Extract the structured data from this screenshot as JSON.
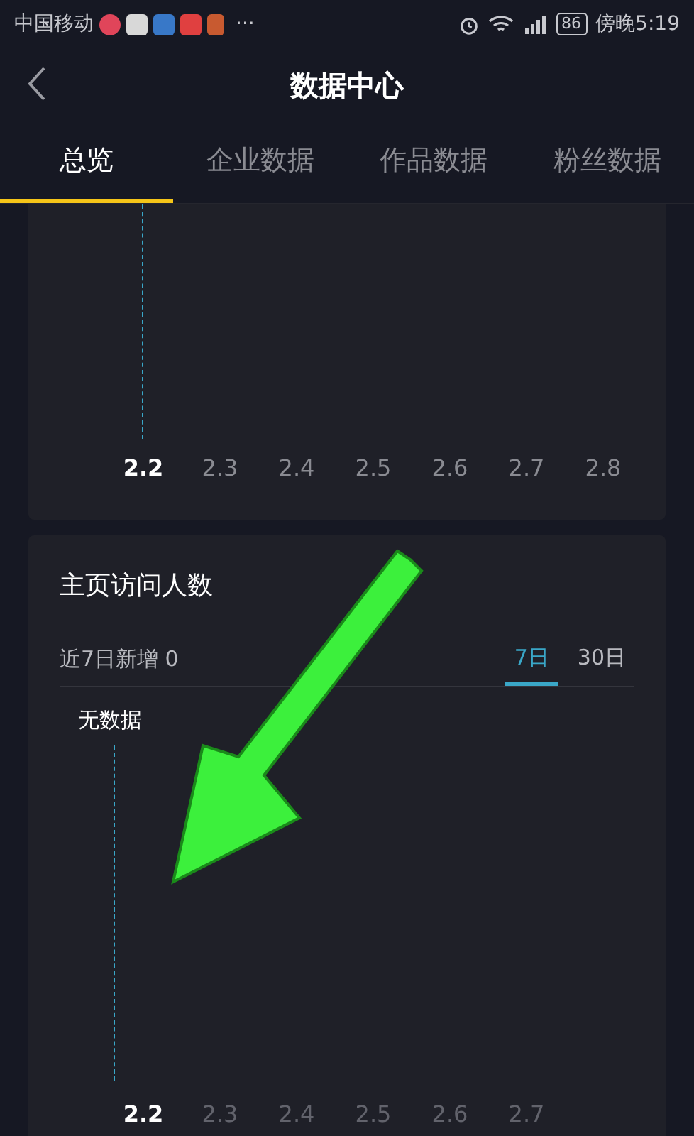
{
  "status_bar": {
    "carrier": "中国移动",
    "more": "···",
    "battery": "86",
    "time": "傍晚5:19"
  },
  "header": {
    "title": "数据中心"
  },
  "tabs": [
    {
      "label": "总览",
      "selected": true
    },
    {
      "label": "企业数据",
      "selected": false
    },
    {
      "label": "作品数据",
      "selected": false
    },
    {
      "label": "粉丝数据",
      "selected": false
    }
  ],
  "trend_card": {
    "has_data": true,
    "axis": [
      {
        "label": "2.2",
        "selected": true
      },
      {
        "label": "2.3",
        "selected": false
      },
      {
        "label": "2.4",
        "selected": false
      },
      {
        "label": "2.5",
        "selected": false
      },
      {
        "label": "2.6",
        "selected": false
      },
      {
        "label": "2.7",
        "selected": false
      },
      {
        "label": "2.8",
        "selected": false
      }
    ]
  },
  "visitors_card": {
    "title": "主页访问人数",
    "summary": "近7日新增 0",
    "ranges": [
      {
        "label": "7日",
        "selected": true
      },
      {
        "label": "30日",
        "selected": false
      }
    ],
    "empty_label": "无数据",
    "has_data": false,
    "axis": [
      {
        "label": "2.2",
        "selected": true
      },
      {
        "label": "2.3",
        "selected": false
      },
      {
        "label": "2.4",
        "selected": false
      },
      {
        "label": "2.5",
        "selected": false
      },
      {
        "label": "2.6",
        "selected": false
      },
      {
        "label": "2.7",
        "selected": false
      }
    ]
  },
  "annotation": {
    "kind": "arrow"
  }
}
